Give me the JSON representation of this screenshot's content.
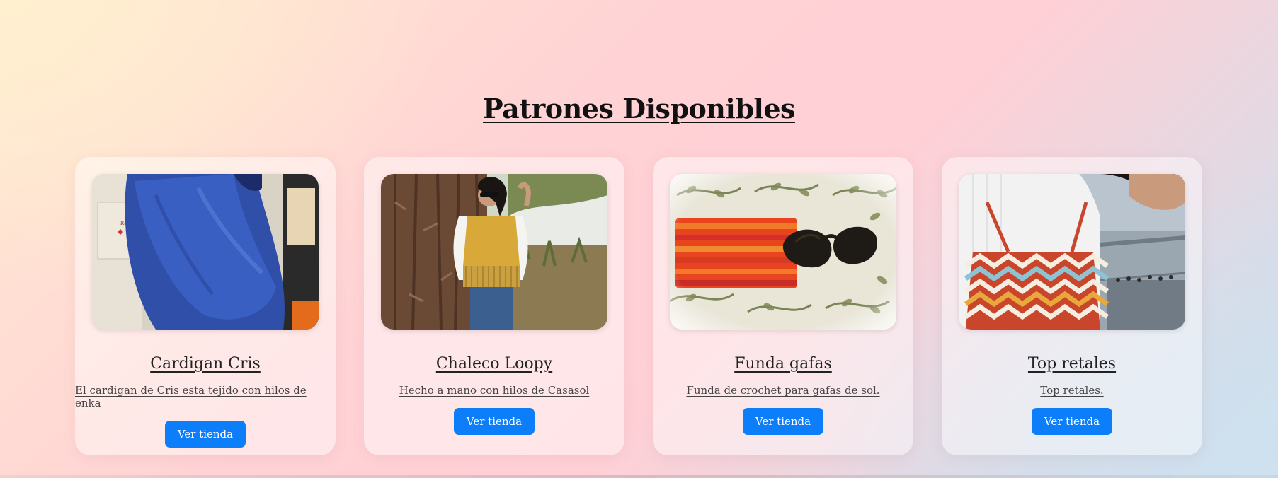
{
  "page": {
    "title": "Patrones Disponibles"
  },
  "cards": [
    {
      "title": "Cardigan Cris",
      "description": "El cardigan de Cris esta tejido con hilos de enka",
      "button_label": "Ver tienda",
      "image_icon": "blue-knitted-cardigan-photo"
    },
    {
      "title": "Chaleco Loopy",
      "description": "Hecho a mano con hilos de Casasol",
      "button_label": "Ver tienda",
      "image_icon": "yellow-fringed-vest-photo"
    },
    {
      "title": "Funda gafas",
      "description": "Funda de crochet para gafas de sol.",
      "button_label": "Ver tienda",
      "image_icon": "crochet-glasses-case-photo"
    },
    {
      "title": "Top retales",
      "description": "Top retales.",
      "button_label": "Ver tienda",
      "image_icon": "zigzag-crochet-top-photo"
    }
  ],
  "colors": {
    "button": "#0d7ef9",
    "title": "#111111"
  }
}
